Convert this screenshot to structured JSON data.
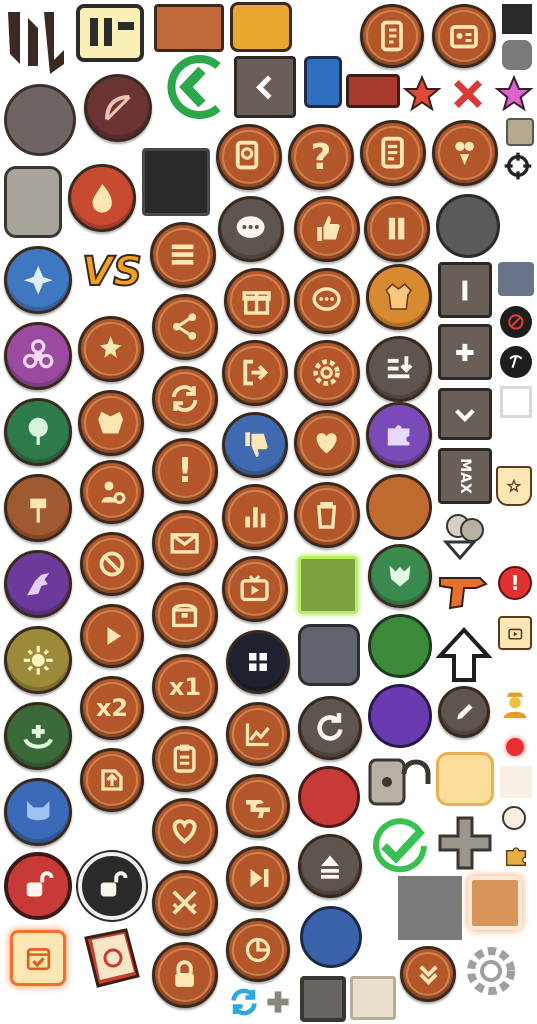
{
  "sheet": {
    "labels": {
      "versus": "VS",
      "x2": "x2",
      "x1": "x1",
      "max": "MAX"
    },
    "colors": {
      "brown": "#b3562a",
      "cream": "#fbe6b4",
      "outline": "#3a2a1e",
      "blue": "#3f78c0",
      "purple": "#6b3a9a",
      "green": "#2f7a4a",
      "olive": "#9a8a3a",
      "red": "#c83a38",
      "grey": "#6e6a6a",
      "lime": "#7fa040"
    },
    "icons": [
      "swap-arrows-icon",
      "battery-icon",
      "brown-panel-icon",
      "yellow-tab-icon",
      "notebook-icon",
      "id-card-icon",
      "dark-square-icon",
      "back-chevron-icon",
      "blue-tab-icon",
      "red-banner-icon",
      "red-star-icon",
      "red-x-icon",
      "pink-star-icon",
      "grey-octagon-icon",
      "grey-circle-icon",
      "bow-icon",
      "back-arrow-green-icon",
      "black-panel-icon",
      "search-doc-icon",
      "question-icon",
      "list-doc-icon",
      "hero-pick-icon",
      "crosshair-icon",
      "fire-icon",
      "chat-icon",
      "thumbs-up-icon",
      "pause-icon",
      "dark-grey-circle-icon",
      "blue-spirit-icon",
      "menu-icon",
      "gift-icon",
      "chat-bubble-icon",
      "jacket-icon",
      "minus-icon",
      "biohazard-icon",
      "share-icon",
      "logout-icon",
      "settings-gear-icon",
      "download-list-icon",
      "plus-icon",
      "no-ads-icon",
      "pickaxe-icon",
      "tree-icon",
      "refresh-arrows-icon",
      "thumbs-down-icon",
      "heart-share-icon",
      "puzzle-icon",
      "chevron-down-icon",
      "exclamation-icon",
      "hammer-icon",
      "bar-chart-icon",
      "trash-icon",
      "max-icon",
      "star-badge-icon",
      "claw-icon",
      "mail-icon",
      "tv-icon",
      "green-frame-icon",
      "wolf-emblem-icon",
      "gun-icon",
      "alert-icon",
      "sun-emblem-icon",
      "play-icon",
      "chest-icon",
      "grid-menu-icon",
      "slate-button-icon",
      "green-circle-icon",
      "up-arrow-icon",
      "tv-ad-icon",
      "heal-icon",
      "x2-icon",
      "x1-icon",
      "trend-chart-icon",
      "replay-icon",
      "purple-circle-icon",
      "pencil-icon",
      "officer-icon",
      "demon-mask-icon",
      "clipboard-icon",
      "guns-icon",
      "red-circle-icon",
      "padlock-grey-icon",
      "cream-button-icon",
      "red-dot-icon",
      "lock-red-icon",
      "lock-dark-icon",
      "crossed-swords-icon",
      "skip-icon",
      "eject-icon",
      "check-icon",
      "grey-plus-icon",
      "puzzle-small-icon",
      "calendar-icon",
      "book-icon",
      "lock-icon",
      "pie-chart-icon",
      "blue-circle-icon",
      "grey-square-icon",
      "orange-frame-icon",
      "double-chevron-icon",
      "gear-outline-icon",
      "cycle-icon",
      "small-plus-icon",
      "grey-button-icon",
      "beige-square-icon"
    ]
  }
}
